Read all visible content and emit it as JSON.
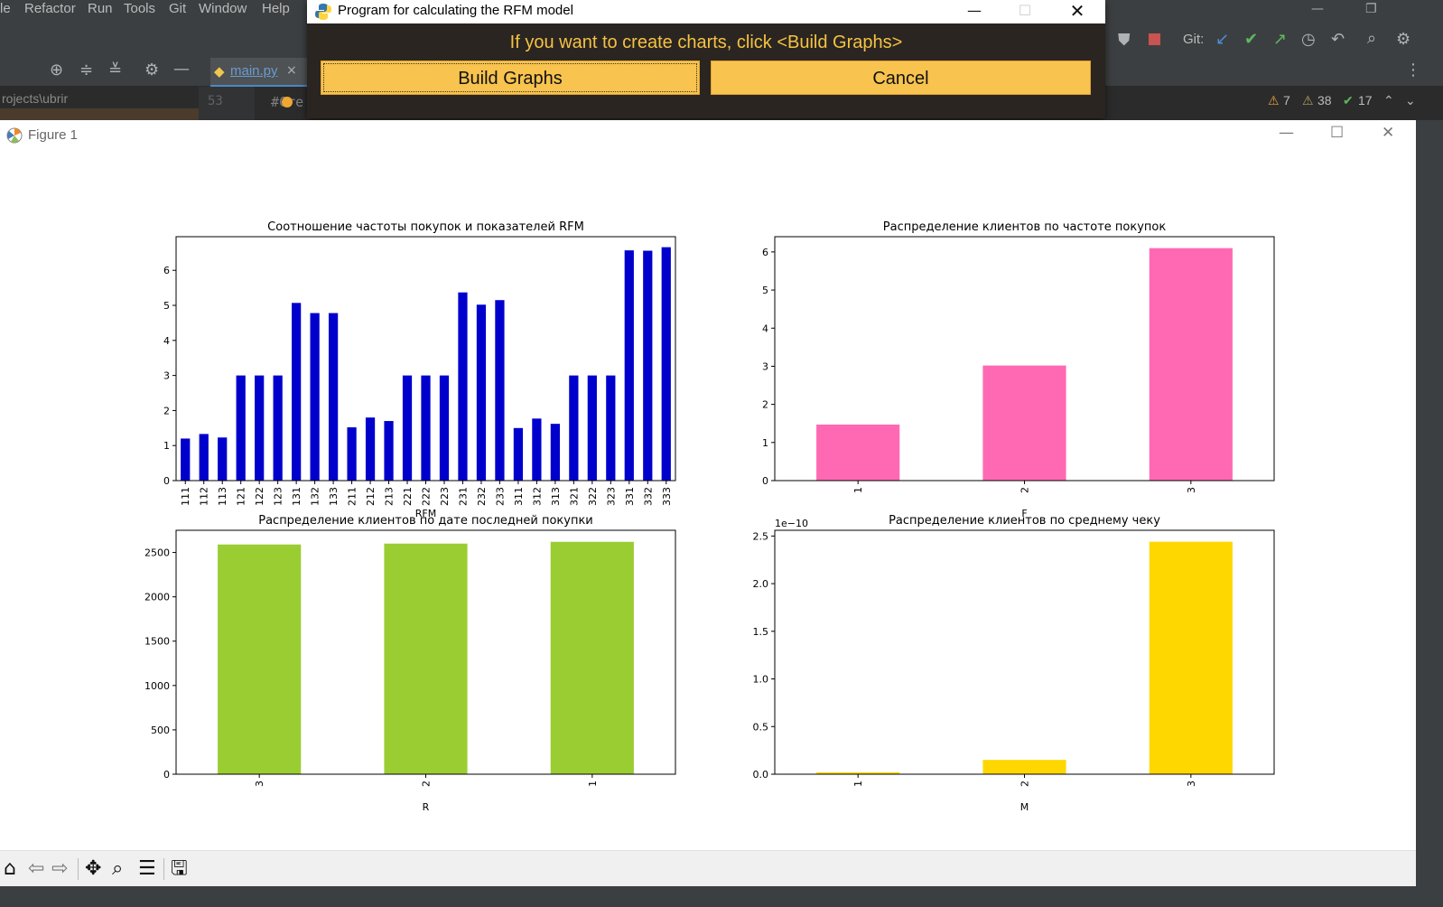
{
  "ide": {
    "menu": [
      "le",
      "Refactor",
      "Run",
      "Tools",
      "Git",
      "Window",
      "Help"
    ],
    "tab_label": "main.py",
    "project_path": "rojects\\ubrir",
    "line_number": "53",
    "code_snippet": "#Cre",
    "git_label": "Git:",
    "inspections": {
      "warnings": "7",
      "weak_warnings": "38",
      "ok": "17"
    }
  },
  "dialog": {
    "title": "Program for calculating the RFM model",
    "message": "If you want to create charts, click <Build Graphs>",
    "build_label": "Build Graphs",
    "cancel_label": "Cancel"
  },
  "figure": {
    "title": "Figure 1"
  },
  "chart_data": [
    {
      "type": "bar",
      "title": "Соотношение частоты покупок и показателей RFM",
      "xlabel": "RFM",
      "ylabel": "",
      "categories": [
        "111",
        "112",
        "113",
        "121",
        "122",
        "123",
        "131",
        "132",
        "133",
        "211",
        "212",
        "213",
        "221",
        "222",
        "223",
        "231",
        "232",
        "233",
        "311",
        "312",
        "313",
        "321",
        "322",
        "323",
        "331",
        "332",
        "333"
      ],
      "values": [
        1.2,
        1.33,
        1.23,
        3.0,
        3.0,
        3.0,
        5.07,
        4.78,
        4.78,
        1.52,
        1.8,
        1.7,
        3.0,
        3.0,
        3.0,
        5.37,
        5.02,
        5.15,
        1.5,
        1.77,
        1.62,
        3.0,
        3.0,
        3.0,
        6.57,
        6.56,
        6.66
      ],
      "ylim": [
        0,
        6.96
      ],
      "yticks": [
        0,
        1,
        2,
        3,
        4,
        5,
        6
      ],
      "color": "#0000cd"
    },
    {
      "type": "bar",
      "title": "Распределение клиентов по частоте покупок",
      "xlabel": "F",
      "ylabel": "",
      "categories": [
        "1",
        "2",
        "3"
      ],
      "values": [
        1.47,
        3.02,
        6.1
      ],
      "ylim": [
        0,
        6.4
      ],
      "yticks": [
        0,
        1,
        2,
        3,
        4,
        5,
        6
      ],
      "color": "#ff69b4"
    },
    {
      "type": "bar",
      "title": "Распределение клиентов по дате последней покупки",
      "xlabel": "R",
      "ylabel": "",
      "categories": [
        "3",
        "2",
        "1"
      ],
      "values": [
        2590,
        2600,
        2620
      ],
      "ylim": [
        0,
        2750
      ],
      "yticks": [
        0,
        500,
        1000,
        1500,
        2000,
        2500
      ],
      "color": "#9acd32"
    },
    {
      "type": "bar",
      "title": "Распределение клиентов по среднему чеку",
      "xlabel": "M",
      "ylabel": "",
      "offset_text": "1e−10",
      "categories": [
        "1",
        "2",
        "3"
      ],
      "values": [
        0.02,
        0.15,
        2.44
      ],
      "ylim": [
        0,
        2.56
      ],
      "yticks": [
        0.0,
        0.5,
        1.0,
        1.5,
        2.0,
        2.5
      ],
      "ytick_labels": [
        "0.0",
        "0.5",
        "1.0",
        "1.5",
        "2.0",
        "2.5"
      ],
      "color": "#ffd700"
    }
  ]
}
